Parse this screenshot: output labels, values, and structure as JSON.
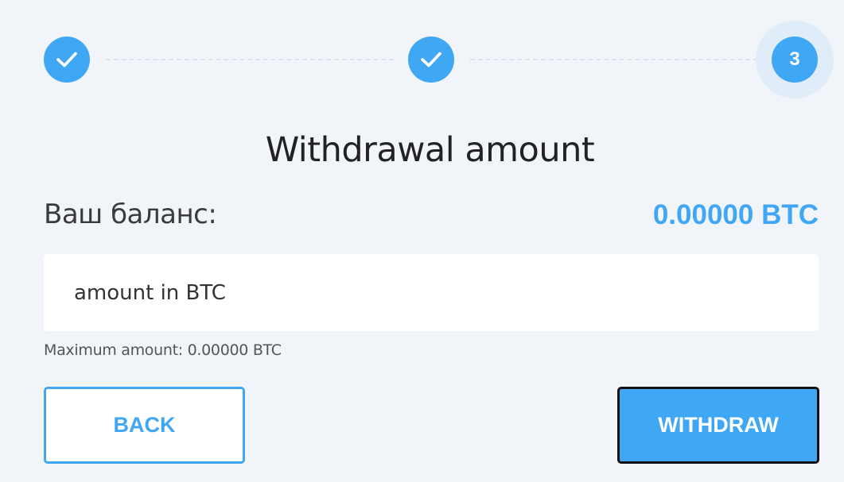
{
  "stepper": {
    "steps": [
      {
        "state": "completed",
        "icon": "check-icon"
      },
      {
        "state": "completed",
        "icon": "check-icon"
      },
      {
        "state": "active",
        "number": "3"
      }
    ]
  },
  "title": "Withdrawal amount",
  "balance": {
    "label": "Ваш баланс:",
    "value": "0.00000 BTC"
  },
  "amount_input": {
    "placeholder": "amount in BTC",
    "value": ""
  },
  "max_amount_text": "Maximum amount: 0.00000 BTC",
  "buttons": {
    "back_label": "BACK",
    "withdraw_label": "WITHDRAW"
  },
  "colors": {
    "accent": "#40a7f4",
    "background": "#f1f5f9",
    "active_halo": "#e0edf8"
  }
}
